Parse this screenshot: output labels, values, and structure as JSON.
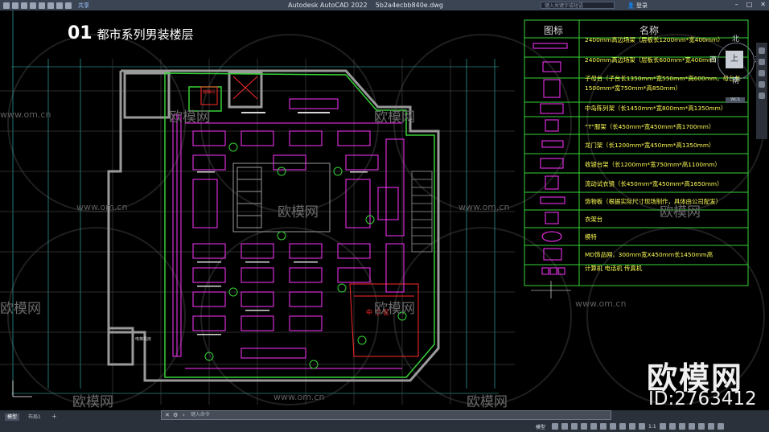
{
  "app": {
    "title": "Autodesk AutoCAD 2022",
    "filename": "5b2a4ecbb840e.dwg",
    "share_label": "共享",
    "search_placeholder": "键入关键字或短语",
    "login_label": "登录"
  },
  "drawing": {
    "number": "01",
    "title": "都市系列男装楼层"
  },
  "viewcube": {
    "north": "北",
    "south": "南",
    "east": "东",
    "west": "西",
    "face": "上",
    "wcs": "WCS"
  },
  "legend": {
    "header_icon": "图标",
    "header_name": "名称",
    "rows": [
      "2400mm高边场架（层板长1200mm*宽400mm）",
      "2400mm高边场架（层板长600mm*宽400mm）",
      "子母台（子台长1350mm*宽550mm*高600mm，母台长",
      "1500mm*宽750mm*高850mm）",
      "中岛陈列架（长1450mm*宽800mm*高1350mm）",
      "“T”服架（长450mm*宽450mm*高1700mm）",
      "龙门架（长1200mm*宽450mm*高1350mm）",
      "收银台架（长1200mm*宽750mm*高1100mm）",
      "流动试衣镜（长450mm*宽450mm*高1650mm）",
      "饰物板（根据实际尺寸现场制作，具体由公司配发）",
      "衣架台",
      "模特",
      "MD饰品网，300mm宽X450mm长1450mm高",
      "计算机  电话机  传真机"
    ]
  },
  "plan_labels": {
    "center_area": "中 空 区",
    "stair_label": "楼梯间",
    "elevator_label": "电梯机房"
  },
  "watermarks": {
    "brand": "欧模网",
    "url": "www.om.cn",
    "big_brand": "欧模网",
    "id": "ID:2763412"
  },
  "layout_tabs": [
    "模型",
    "布局1"
  ],
  "command_placeholder": "键入命令",
  "status": {
    "model_label": "模型",
    "scale": "1:1"
  },
  "colors": {
    "yellow": "#ffff55",
    "green": "#36d336",
    "magenta": "#ff33ff",
    "cyan": "#33e0ff",
    "gray": "#9a9a9a",
    "red": "#ff2a2a"
  }
}
